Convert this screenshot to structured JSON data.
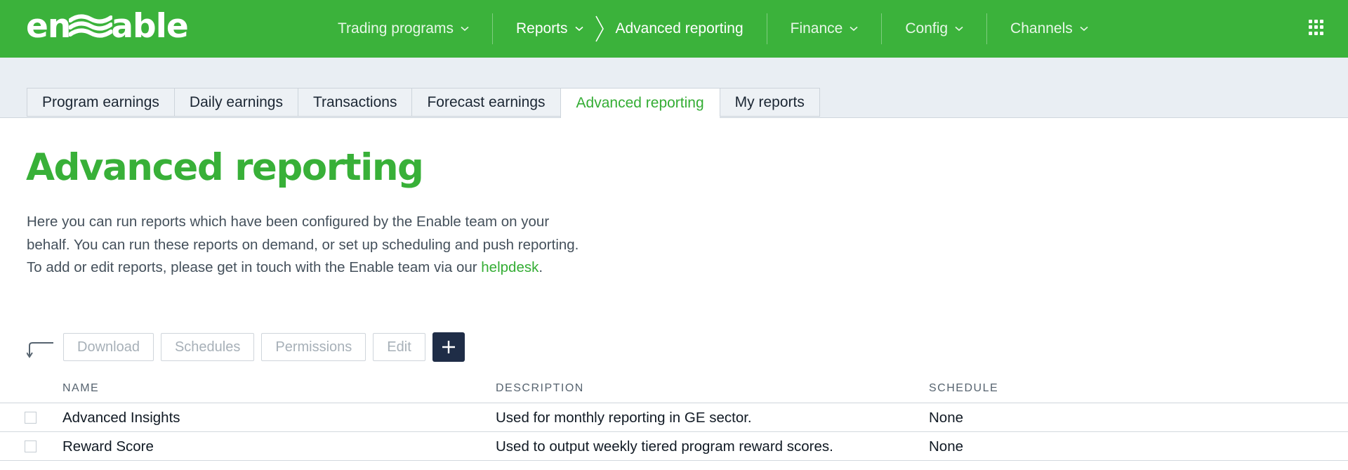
{
  "brand": {
    "logo_text_left": "en",
    "logo_text_right": "able",
    "logo_full": "enable",
    "color": "#3bb23b"
  },
  "nav": {
    "trading_programs": "Trading programs",
    "reports": "Reports",
    "current_page": "Advanced reporting",
    "finance": "Finance",
    "config": "Config",
    "channels": "Channels"
  },
  "tabs": [
    {
      "label": "Program earnings"
    },
    {
      "label": "Daily earnings"
    },
    {
      "label": "Transactions"
    },
    {
      "label": "Forecast earnings"
    },
    {
      "label": "Advanced reporting",
      "active": true
    },
    {
      "label": "My reports"
    }
  ],
  "page": {
    "title": "Advanced reporting",
    "intro_text": "Here you can run reports which have been configured by the Enable team on your behalf. You can run these reports on demand, or set up scheduling and push reporting. To add or edit reports, please get in touch with the Enable team via our ",
    "intro_link": "helpdesk",
    "intro_end": "."
  },
  "toolbar": {
    "download": "Download",
    "schedules": "Schedules",
    "permissions": "Permissions",
    "edit": "Edit"
  },
  "table": {
    "columns": {
      "name": "NAME",
      "description": "DESCRIPTION",
      "schedule": "SCHEDULE"
    },
    "rows": [
      {
        "name": "Advanced Insights",
        "description": "Used for monthly reporting in GE sector.",
        "schedule": "None"
      },
      {
        "name": "Reward Score",
        "description": "Used to output weekly tiered program reward scores.",
        "schedule": "None"
      }
    ]
  },
  "colors": {
    "accent": "#34ad34",
    "dark_button": "#1f2d47",
    "tab_band": "#e9eef3"
  }
}
